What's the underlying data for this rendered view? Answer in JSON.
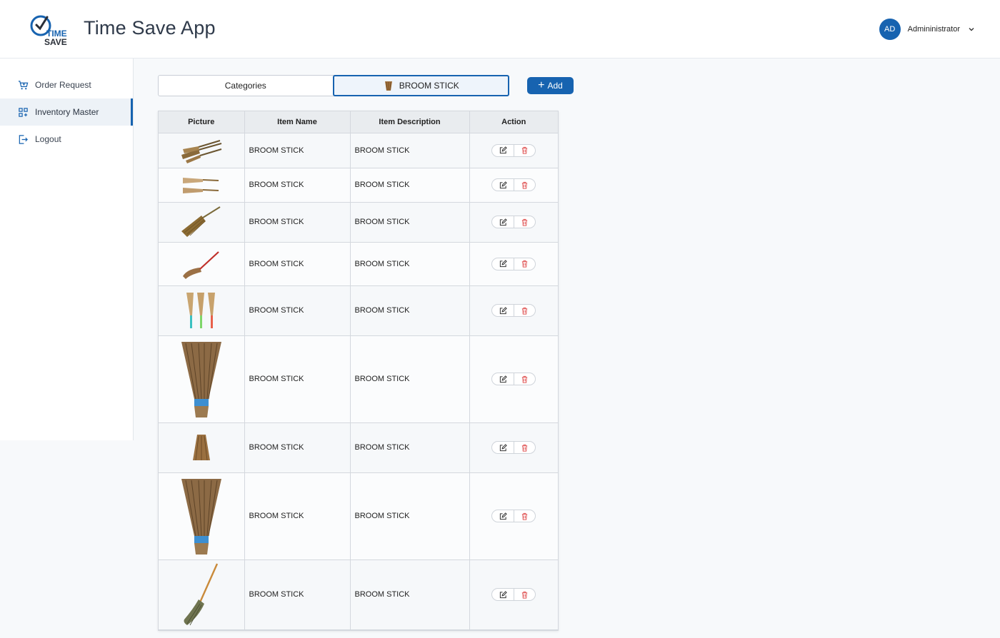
{
  "app": {
    "title": "Time Save App",
    "logo_text_top": "TIME",
    "logo_text_bottom": "SAVE"
  },
  "user": {
    "initials": "AD",
    "name": "Admininistrator"
  },
  "sidebar": {
    "items": [
      {
        "label": "Order Request",
        "icon": "cart-icon",
        "active": false
      },
      {
        "label": "Inventory Master",
        "icon": "grid-icon",
        "active": true
      },
      {
        "label": "Logout",
        "icon": "logout-icon",
        "active": false
      }
    ]
  },
  "toolbar": {
    "tabs": [
      {
        "label": "Categories"
      },
      {
        "label": "BROOM STICK"
      }
    ],
    "add_label": "Add"
  },
  "table": {
    "headers": [
      "Picture",
      "Item Name",
      "Item Description",
      "Action"
    ],
    "rows": [
      {
        "name": "BROOM STICK",
        "description": "BROOM STICK"
      },
      {
        "name": "BROOM STICK",
        "description": "BROOM STICK"
      },
      {
        "name": "BROOM STICK",
        "description": "BROOM STICK"
      },
      {
        "name": "BROOM STICK",
        "description": "BROOM STICK"
      },
      {
        "name": "BROOM STICK",
        "description": "BROOM STICK"
      },
      {
        "name": "BROOM STICK",
        "description": "BROOM STICK"
      },
      {
        "name": "BROOM STICK",
        "description": "BROOM STICK"
      },
      {
        "name": "BROOM STICK",
        "description": "BROOM STICK"
      },
      {
        "name": "BROOM STICK",
        "description": "BROOM STICK"
      }
    ]
  },
  "colors": {
    "primary": "#1763b0",
    "delete": "#e05555"
  }
}
